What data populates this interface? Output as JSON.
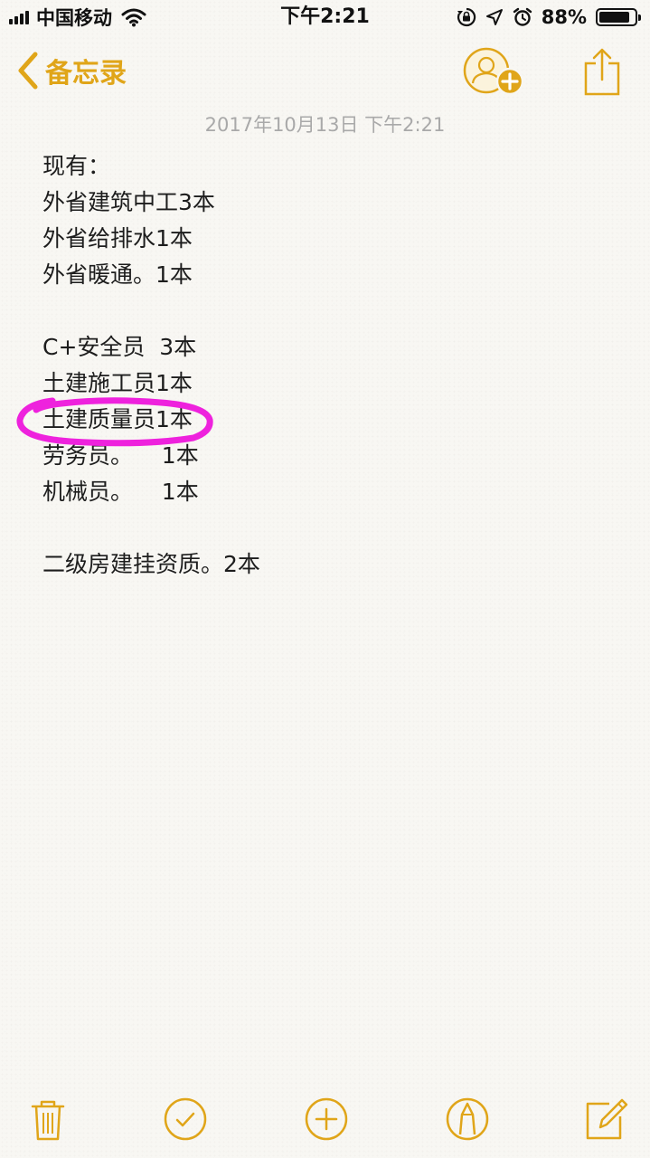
{
  "status_bar": {
    "carrier": "中国移动",
    "time": "下午2:21",
    "battery_percent": "88%",
    "battery_level": 0.88,
    "icons": [
      "signal-icon",
      "wifi-icon",
      "orientation-lock-icon",
      "location-icon",
      "alarm-icon",
      "battery-icon"
    ]
  },
  "nav": {
    "back_label": "备忘录",
    "icons": [
      "chevron-left-icon",
      "add-person-icon",
      "share-icon"
    ]
  },
  "note": {
    "date": "2017年10月13日 下午2:21",
    "lines": [
      "现有：",
      "外省建筑中工3本",
      "外省给排水1本",
      "外省暖通。1本",
      "",
      "C+安全员  3本",
      "土建施工员1本",
      "土建质量员1本",
      "劳务员。    1本",
      "机械员。    1本",
      "",
      "二级房建挂资质。2本"
    ],
    "highlight_color": "#ee22dd"
  },
  "toolbar": {
    "icons": [
      "trash-icon",
      "checklist-icon",
      "add-icon",
      "markup-icon",
      "compose-icon"
    ]
  },
  "accent_color": "#e0a519"
}
